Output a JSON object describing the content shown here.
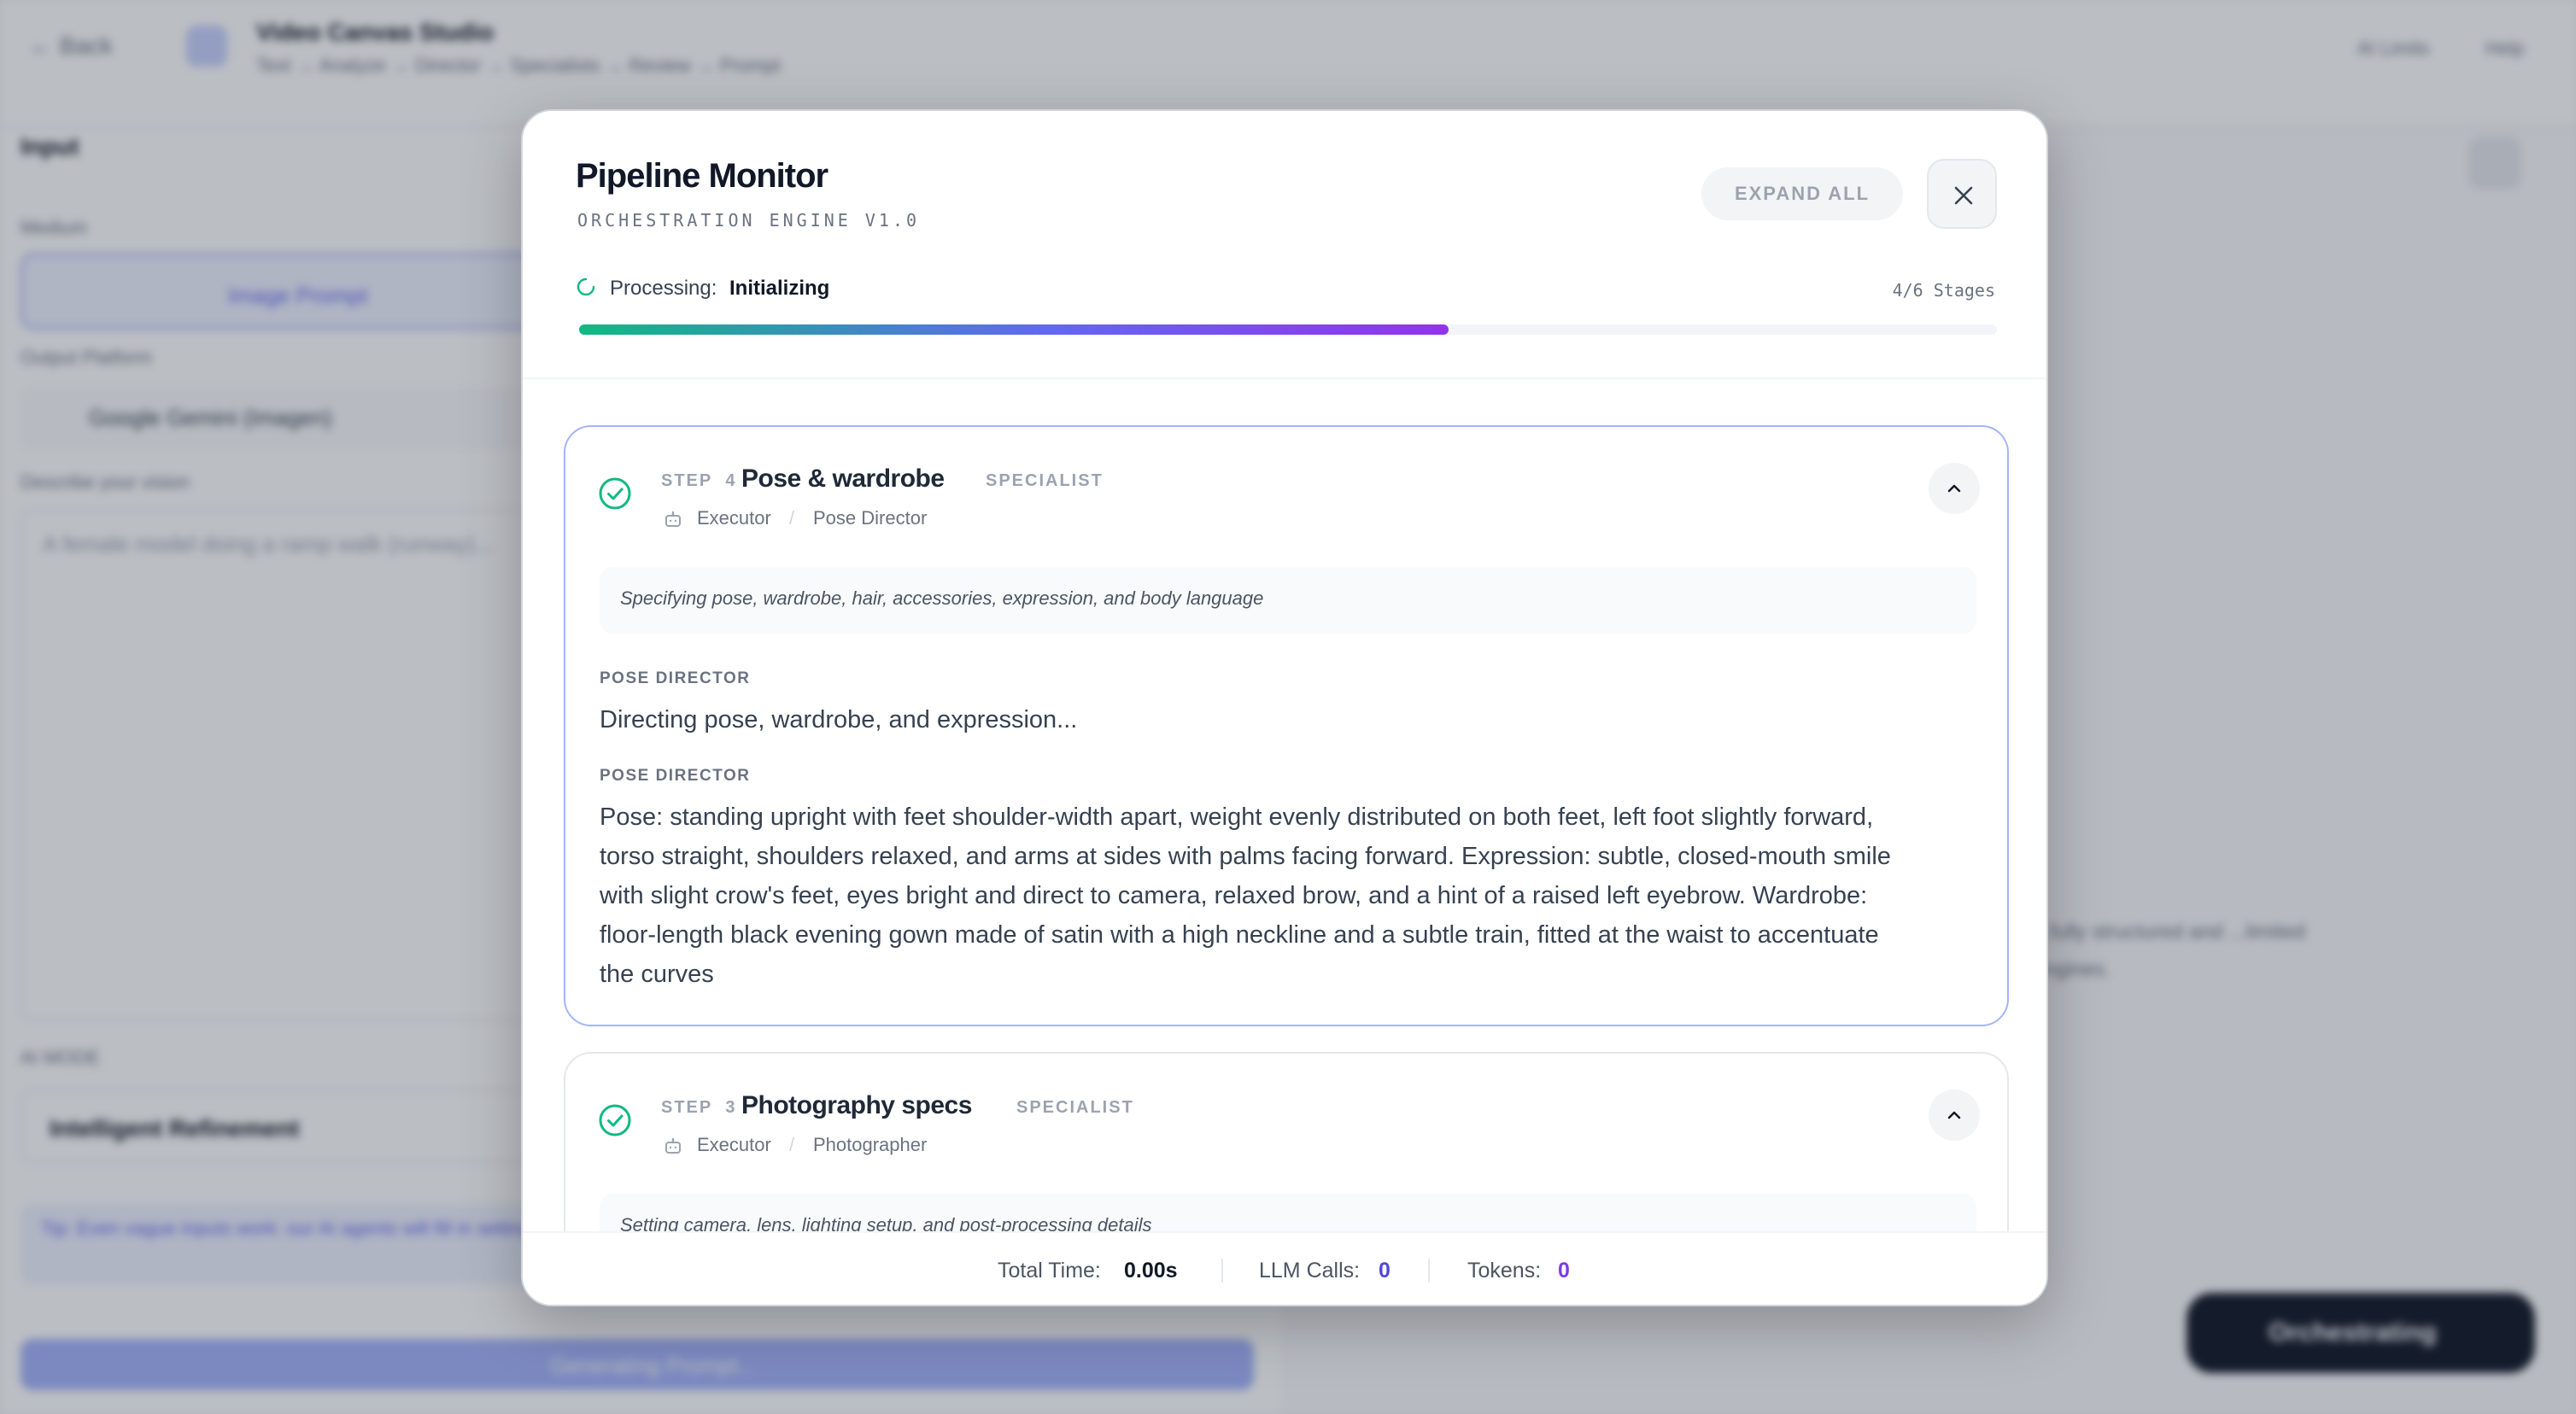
{
  "background": {
    "back_label": "Back",
    "app_title": "Video Canvas Studio",
    "breadcrumb": "Text → Analyze → Director → Specialists → Review → Prompt",
    "top_right_1": "AI Limits",
    "top_right_2": "Help",
    "input_heading": "Input",
    "medium_label": "Medium",
    "image_prompt_button": "Image Prompt",
    "output_platform_label": "Output Platform",
    "output_platform_value": "Google Gemini (Imagen)",
    "describe_label": "Describe your vision",
    "describe_text": "A female model doing a ramp walk (runway)...",
    "ai_mode_label": "AI MODE",
    "refinement_value": "Intelligent Refinement",
    "tip_text": "Tip: Even vague inputs work: our AI agents will fill in settings to create a complete, specific prompt.",
    "generate_button": "Generating Prompt...",
    "right_panel_text": "...fully structured and ...limited engines.",
    "orchestrating_button": "Orchestrating"
  },
  "modal": {
    "title": "Pipeline Monitor",
    "subtitle": "ORCHESTRATION ENGINE V1.0",
    "expand_all_label": "EXPAND ALL",
    "status_label": "Processing:",
    "status_value": "Initializing",
    "stages_label": "4/6 Stages",
    "progress": 0.613
  },
  "steps": [
    {
      "step_label": "STEP",
      "number": "4",
      "title": "Pose & wardrobe",
      "tag": "SPECIALIST",
      "role": "Executor",
      "agent": "Pose Director",
      "description": "Specifying pose, wardrobe, hair, accessories, expression, and body language",
      "outputs": [
        {
          "label": "POSE DIRECTOR",
          "lines": [
            "Directing pose, wardrobe, and expression..."
          ]
        },
        {
          "label": "POSE DIRECTOR",
          "lines": [
            "Pose: standing upright with feet shoulder-width apart, weight evenly distributed on both feet, left foot slightly forward,",
            "torso straight, shoulders relaxed, and arms at sides with palms facing forward. Expression: subtle, closed-mouth smile",
            "with slight crow's feet, eyes bright and direct to camera, relaxed brow, and a hint of a raised left eyebrow. Wardrobe:",
            "floor-length black evening gown made of satin with a high neckline and a subtle train, fitted at the waist to accentuate",
            "the curves"
          ]
        }
      ]
    },
    {
      "step_label": "STEP",
      "number": "3",
      "title": "Photography specs",
      "tag": "SPECIALIST",
      "role": "Executor",
      "agent": "Photographer",
      "description": "Setting camera, lens, lighting setup, and post-processing details"
    }
  ],
  "footer": {
    "total_time_label": "Total Time:",
    "total_time_value": "0.00s",
    "llm_calls_label": "LLM Calls:",
    "llm_calls_value": "0",
    "tokens_label": "Tokens:",
    "tokens_value": "0"
  },
  "colors": {
    "accent": "#4f46e5",
    "success": "#10b981",
    "purple": "#7c3aed"
  }
}
